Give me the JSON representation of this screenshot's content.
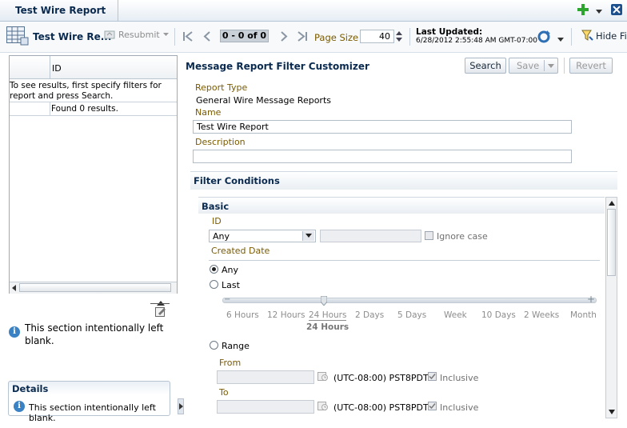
{
  "tab": {
    "title": "Test Wire Report"
  },
  "toolbar": {
    "report_title": "Test Wire Re...",
    "resubmit_label": "Resubmit",
    "page_indicator": "0 - 0 of 0",
    "page_size_label": "Page Size",
    "page_size_value": "40",
    "last_updated_label": "Last Updated:",
    "last_updated_value": "6/28/2012 2:55:48 AM GMT-07:00",
    "hide_filters_label": "Hide Fi"
  },
  "results": {
    "column_id": "ID",
    "message": "To see results, first specify filters for report and press Search.",
    "found": "Found 0 results."
  },
  "left_info": "This section intentionally left blank.",
  "details": {
    "title": "Details",
    "text": "This section intentionally left blank."
  },
  "customizer": {
    "title": "Message Report Filter Customizer",
    "search_label": "Search",
    "save_label": "Save",
    "revert_label": "Revert",
    "report_type_label": "Report Type",
    "report_type_value": "General Wire Message Reports",
    "name_label": "Name",
    "name_value": "Test Wire Report",
    "description_label": "Description",
    "description_value": ""
  },
  "filter": {
    "title": "Filter Conditions",
    "basic_title": "Basic",
    "id_label": "ID",
    "id_operator": "Any",
    "ignore_case_label": "Ignore case",
    "created_date_label": "Created Date",
    "any_label": "Any",
    "last_label": "Last",
    "slider_ticks": [
      "6 Hours",
      "12 Hours",
      "24 Hours",
      "2 Days",
      "5 Days",
      "Week",
      "10 Days",
      "2 Weeks",
      "Month"
    ],
    "slider_selected": "24 Hours",
    "range_label": "Range",
    "from_label": "From",
    "to_label": "To",
    "timezone": "(UTC-08:00) PST8PDT",
    "inclusive_label": "Inclusive"
  },
  "colors": {
    "title_blue": "#0a2a4f",
    "label_gold": "#7a5b00",
    "info_blue": "#3b82c4",
    "add_green": "#2ea52e"
  }
}
